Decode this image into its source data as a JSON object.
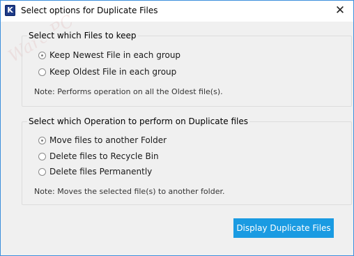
{
  "window": {
    "title": "Select options for Duplicate Files",
    "app_icon_letter": "K",
    "close_glyph": "✕",
    "border_color": "#3c8fdc"
  },
  "watermark": {
    "text": "Ware PC"
  },
  "keep_group": {
    "title": "Select which Files to keep",
    "options": [
      {
        "label": "Keep Newest File in each group",
        "checked": true
      },
      {
        "label": "Keep Oldest File in each group",
        "checked": false
      }
    ],
    "note": "Note: Performs operation on all the Oldest file(s)."
  },
  "operation_group": {
    "title": "Select which Operation to perform on Duplicate files",
    "options": [
      {
        "label": "Move files to another Folder",
        "checked": true
      },
      {
        "label": "Delete files to Recycle Bin",
        "checked": false
      },
      {
        "label": "Delete files Permanently",
        "checked": false
      }
    ],
    "note": "Note: Moves the selected file(s) to another folder."
  },
  "actions": {
    "display_button_label": "Display Duplicate Files",
    "accent_color": "#1a9be2"
  },
  "icons": {
    "app": "kernel-app-icon",
    "close": "close-icon"
  }
}
